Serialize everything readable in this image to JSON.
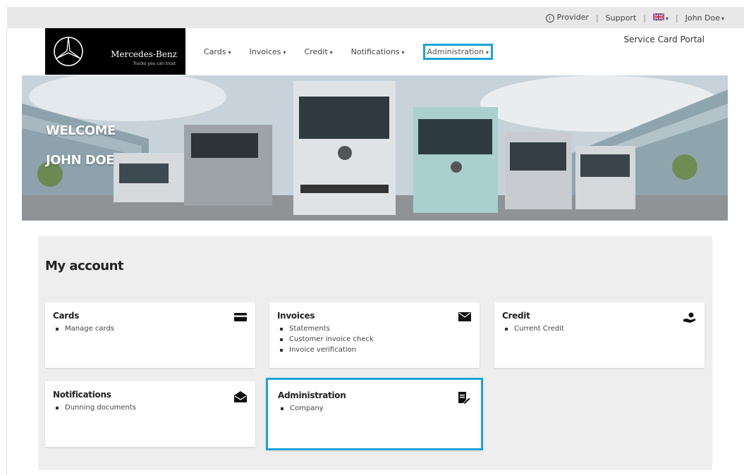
{
  "topbar": {
    "provider": "Provider",
    "support": "Support",
    "user": "John Doe"
  },
  "header": {
    "brand": "Mercedes-Benz",
    "tagline": "Trucks you can trust",
    "portal_title": "Service Card Portal",
    "nav": [
      {
        "label": "Cards"
      },
      {
        "label": "Invoices"
      },
      {
        "label": "Credit"
      },
      {
        "label": "Notifications"
      },
      {
        "label": "Administration"
      }
    ]
  },
  "banner": {
    "line1": "WELCOME",
    "line2": "JOHN DOE"
  },
  "account": {
    "title": "My account",
    "cards": [
      {
        "title": "Cards",
        "icon": "credit-card-icon",
        "items": [
          "Manage cards"
        ]
      },
      {
        "title": "Invoices",
        "icon": "envelope-icon",
        "items": [
          "Statements",
          "Customer invoice check",
          "Invoice verification"
        ]
      },
      {
        "title": "Credit",
        "icon": "hand-coin-icon",
        "items": [
          "Current Credit"
        ]
      },
      {
        "title": "Notifications",
        "icon": "open-envelope-icon",
        "items": [
          "Dunning documents"
        ]
      },
      {
        "title": "Administration",
        "icon": "document-edit-icon",
        "items": [
          "Company"
        ]
      }
    ]
  },
  "colors": {
    "accent": "#1ba3dd",
    "panel_bg": "#eeeeee",
    "topbar_bg": "#e8e8e8"
  }
}
